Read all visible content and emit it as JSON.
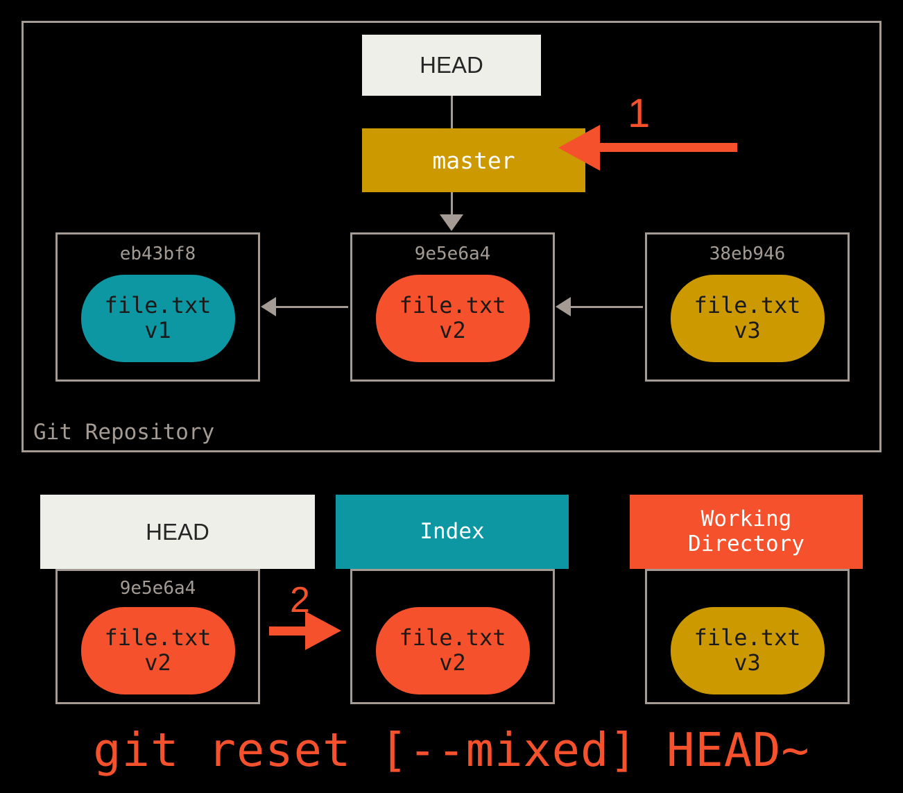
{
  "repository": {
    "label": "Git Repository",
    "head_label": "HEAD",
    "branch_label": "master",
    "commits": [
      {
        "sha": "eb43bf8",
        "file": "file.txt",
        "version": "v1",
        "color": "#0d97a3"
      },
      {
        "sha": "9e5e6a4",
        "file": "file.txt",
        "version": "v2",
        "color": "#f4512c"
      },
      {
        "sha": "38eb946",
        "file": "file.txt",
        "version": "v3",
        "color": "#cc9a00"
      }
    ]
  },
  "annotations": {
    "step_one": "1",
    "step_two": "2"
  },
  "areas": {
    "head": {
      "title": "HEAD",
      "sha": "9e5e6a4",
      "file": "file.txt",
      "version": "v2",
      "header_color": "#efefe9",
      "blob_color": "#f4512c"
    },
    "index": {
      "title": "Index",
      "file": "file.txt",
      "version": "v2",
      "header_color": "#0d97a3",
      "blob_color": "#f4512c"
    },
    "working_directory": {
      "title_line1": "Working",
      "title_line2": "Directory",
      "file": "file.txt",
      "version": "v3",
      "header_color": "#f4512c",
      "blob_color": "#cc9a00"
    }
  },
  "caption": "git reset [--mixed] HEAD~",
  "colors": {
    "background": "#000000",
    "border_gray": "#a39b94",
    "teal": "#0d97a3",
    "orange": "#f4512c",
    "gold": "#cc9a00",
    "offwhite": "#efefe9"
  }
}
